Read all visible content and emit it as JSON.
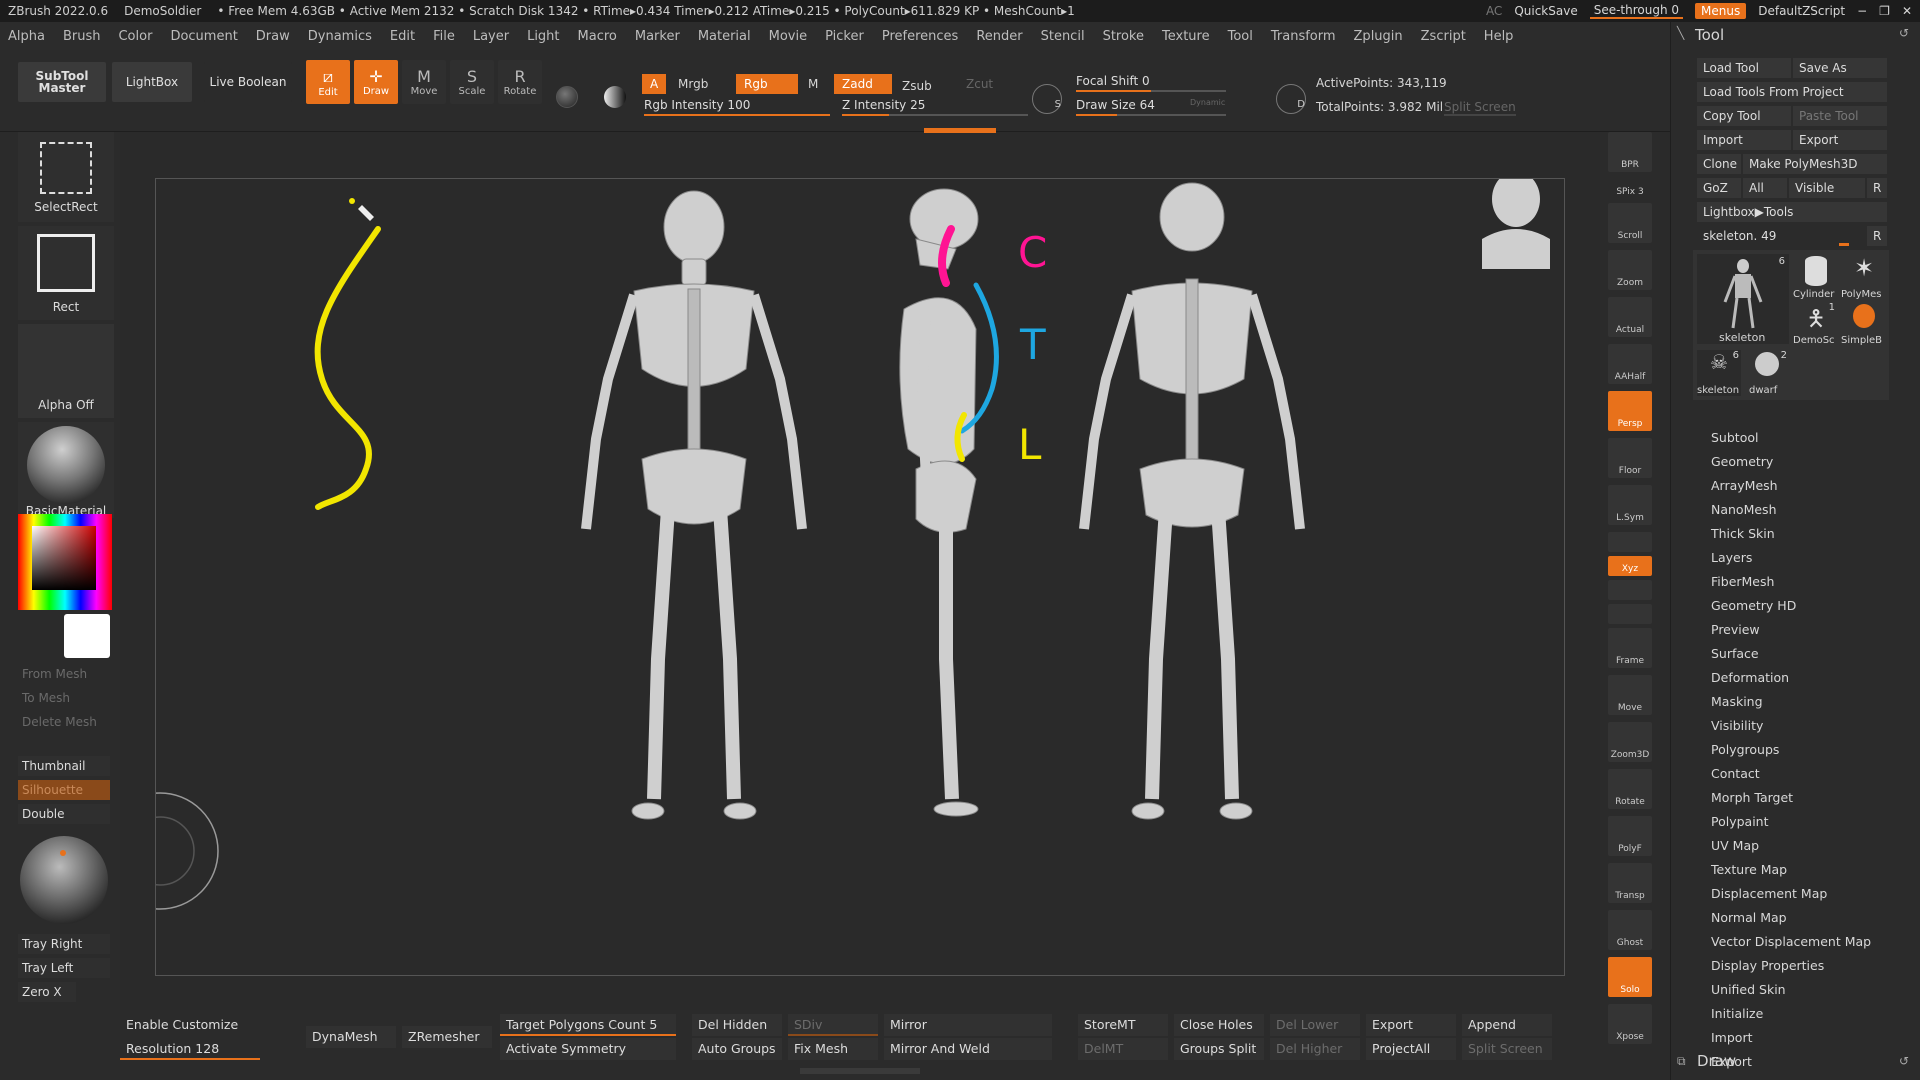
{
  "colors": {
    "accent": "#e8711b",
    "magenta": "#ff1493",
    "cyan": "#1ea7e1",
    "yellow": "#f2e600"
  },
  "titlebar": {
    "app": "ZBrush 2022.0.6",
    "project": "DemoSoldier",
    "stats": "• Free Mem 4.63GB • Active Mem 2132 • Scratch Disk 1342 • RTime▸0.434 Timer▸0.212 ATime▸0.215 • PolyCount▸611.829 KP • MeshCount▸1",
    "ac": "AC",
    "quicksave": "QuickSave",
    "seethrough": "See-through  0",
    "menus": "Menus",
    "script": "DefaultZScript"
  },
  "menubar": [
    "Alpha",
    "Brush",
    "Color",
    "Document",
    "Draw",
    "Dynamics",
    "Edit",
    "File",
    "Layer",
    "Light",
    "Macro",
    "Marker",
    "Material",
    "Movie",
    "Picker",
    "Preferences",
    "Render",
    "Stencil",
    "Stroke",
    "Texture",
    "Tool",
    "Transform",
    "Zplugin",
    "Zscript",
    "Help"
  ],
  "toolbar": {
    "subtool_master": "SubTool Master",
    "lightbox": "LightBox",
    "live_boolean": "Live Boolean",
    "edit": "Edit",
    "draw": "Draw",
    "move": "Move",
    "scale": "Scale",
    "rotate": "Rotate",
    "a": "A",
    "mrgb": "Mrgb",
    "rgb": "Rgb",
    "m": "M",
    "zadd": "Zadd",
    "zsub": "Zsub",
    "zcut": "Zcut",
    "rgb_intensity": "Rgb Intensity 100",
    "rgb_intensity_value": 100,
    "z_intensity": "Z Intensity 25",
    "z_intensity_value": 25,
    "focal_shift": "Focal Shift 0",
    "draw_size": "Draw Size 64",
    "dynamic": "Dynamic",
    "active_points": "ActivePoints: 343,119",
    "total_points": "TotalPoints: 3.982 Mil",
    "split_screen": "Split Screen"
  },
  "leftpanel": {
    "selectrect": "SelectRect",
    "rect": "Rect",
    "alpha_off": "Alpha Off",
    "material": "BasicMaterial",
    "from_mesh": "From Mesh",
    "to_mesh": "To Mesh",
    "delete_mesh": "Delete Mesh",
    "thumbnail": "Thumbnail",
    "silhouette": "Silhouette",
    "double": "Double",
    "tray_right": "Tray Right",
    "tray_left": "Tray Left",
    "zero_x": "Zero X"
  },
  "viewport": {
    "label_c": "C",
    "label_t": "T",
    "label_l": "L"
  },
  "rightstrip": [
    "BPR",
    "SPix 3",
    "Scroll",
    "Zoom",
    "Actual",
    "AAHalf",
    "Persp",
    "Floor",
    "L.Sym",
    "",
    "Xyz",
    "",
    "",
    "Frame",
    "Move",
    "Zoom3D",
    "Rotate",
    "PolyF",
    "Transp",
    "Ghost",
    "Solo",
    "Xpose"
  ],
  "toolpanel": {
    "title": "Tool",
    "load_tool": "Load Tool",
    "save_as": "Save As",
    "load_from_project": "Load Tools From Project",
    "copy_tool": "Copy Tool",
    "paste_tool": "Paste Tool",
    "import": "Import",
    "export": "Export",
    "clone": "Clone",
    "make_polymesh": "Make PolyMesh3D",
    "goz": "GoZ",
    "all": "All",
    "visible": "Visible",
    "r": "R",
    "lightbox_tools": "Lightbox▶Tools",
    "skeleton_slider": "skeleton. 49",
    "thumbs": [
      "skeleton",
      "Cylinder",
      "PolyMes",
      "DemoSc",
      "SimpleB",
      "skeleton",
      "dwarf"
    ],
    "thumb_counts": [
      "6",
      "1",
      "6",
      "2"
    ],
    "menu": [
      "Subtool",
      "Geometry",
      "ArrayMesh",
      "NanoMesh",
      "Thick Skin",
      "Layers",
      "FiberMesh",
      "Geometry HD",
      "Preview",
      "Surface",
      "Deformation",
      "Masking",
      "Visibility",
      "Polygroups",
      "Contact",
      "Morph Target",
      "Polypaint",
      "UV Map",
      "Texture Map",
      "Displacement Map",
      "Normal Map",
      "Vector Displacement Map",
      "Display Properties",
      "Unified Skin",
      "Initialize",
      "Import",
      "Export"
    ],
    "draw_footer": "Draw"
  },
  "bottombar": {
    "enable_customize": "Enable Customize",
    "resolution": "Resolution 128",
    "dynamesh": "DynaMesh",
    "zremesher": "ZRemesher",
    "target_polys": "Target Polygons Count 5",
    "activate_symmetry": "Activate Symmetry",
    "del_hidden": "Del Hidden",
    "auto_groups": "Auto Groups",
    "sdiv": "SDiv",
    "fix_mesh": "Fix Mesh",
    "mirror": "Mirror",
    "mirror_weld": "Mirror And Weld",
    "storemt": "StoreMT",
    "delmt": "DelMT",
    "close_holes": "Close Holes",
    "groups_split": "Groups Split",
    "del_lower": "Del Lower",
    "del_higher": "Del Higher",
    "export": "Export",
    "projectall": "ProjectAll",
    "append": "Append",
    "split_screen": "Split Screen"
  }
}
